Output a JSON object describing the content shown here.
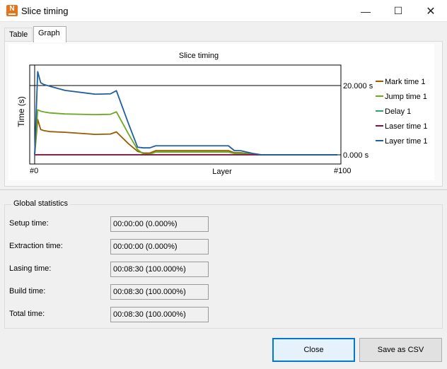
{
  "window": {
    "title": "Slice timing",
    "app_icon_letter": "N",
    "controls": {
      "minimize": "—",
      "maximize": "☐",
      "close": "✕"
    }
  },
  "tabs": [
    {
      "label": "Table",
      "active": false
    },
    {
      "label": "Graph",
      "active": true
    }
  ],
  "chart_data": {
    "type": "line",
    "title": "Slice timing",
    "xlabel": "Layer",
    "ylabel": "Time (s)",
    "x_tick_labels": [
      "#0",
      "#100"
    ],
    "y_tick_labels": [
      "0.000 s",
      "20.000 s"
    ],
    "xlim": [
      0,
      100
    ],
    "ylim": [
      -2,
      26
    ],
    "grid": false,
    "legend_position": "right",
    "x": [
      0,
      1,
      2,
      3,
      5,
      10,
      20,
      25,
      27,
      31,
      34,
      36,
      38,
      40,
      42,
      50,
      60,
      64,
      66,
      68,
      72,
      75,
      80,
      90,
      100
    ],
    "series": [
      {
        "name": "Mark time 1",
        "color": "#9c5a00",
        "values": [
          0,
          10.2,
          7.3,
          7.0,
          6.7,
          6.5,
          5.9,
          6.0,
          6.6,
          3.2,
          1.0,
          0.5,
          0.5,
          1.2,
          1.2,
          1.2,
          1.2,
          1.2,
          0.6,
          0.6,
          0.2,
          0,
          0,
          0,
          0
        ]
      },
      {
        "name": "Jump time 1",
        "color": "#6aaa1e",
        "values": [
          0,
          13.0,
          12.6,
          12.4,
          12.1,
          11.8,
          11.6,
          11.7,
          12.4,
          6.0,
          1.5,
          0.2,
          0.2,
          0.8,
          0.8,
          0.8,
          0.8,
          0.8,
          0.4,
          0.4,
          0.1,
          0,
          0,
          0,
          0
        ]
      },
      {
        "name": "Delay 1",
        "color": "#2fa06e",
        "values": [
          0,
          0.05,
          0.05,
          0.05,
          0.05,
          0.05,
          0.05,
          0.05,
          0.05,
          0.05,
          0.05,
          0.05,
          0.05,
          0.05,
          0.05,
          0.05,
          0.05,
          0.05,
          0.05,
          0.05,
          0.05,
          0,
          0,
          0,
          0
        ]
      },
      {
        "name": "Laser time 1",
        "color": "#8a0f45",
        "values": [
          0,
          0,
          0,
          0,
          0,
          0,
          0,
          0,
          0,
          0,
          0,
          0,
          0,
          0,
          0,
          0,
          0,
          0,
          0,
          0,
          0,
          0,
          0,
          0,
          0
        ]
      },
      {
        "name": "Layer time 1",
        "color": "#1f5fa0",
        "values": [
          0,
          24.0,
          20.8,
          20.3,
          19.8,
          18.6,
          17.5,
          17.6,
          18.5,
          9.0,
          2.2,
          2.0,
          2.0,
          2.6,
          2.6,
          2.6,
          2.6,
          2.6,
          1.2,
          1.2,
          0.4,
          0,
          0,
          0,
          0
        ]
      }
    ]
  },
  "stats": {
    "group_title": "Global statistics",
    "rows": [
      {
        "label": "Setup time:",
        "value": "00:00:00 (0.000%)"
      },
      {
        "label": "Extraction time:",
        "value": "00:00:00 (0.000%)"
      },
      {
        "label": "Lasing time:",
        "value": "00:08:30 (100.000%)"
      },
      {
        "label": "Build time:",
        "value": "00:08:30 (100.000%)"
      },
      {
        "label": "Total time:",
        "value": "00:08:30 (100.000%)"
      }
    ]
  },
  "buttons": {
    "close": "Close",
    "save_csv": "Save as CSV"
  }
}
